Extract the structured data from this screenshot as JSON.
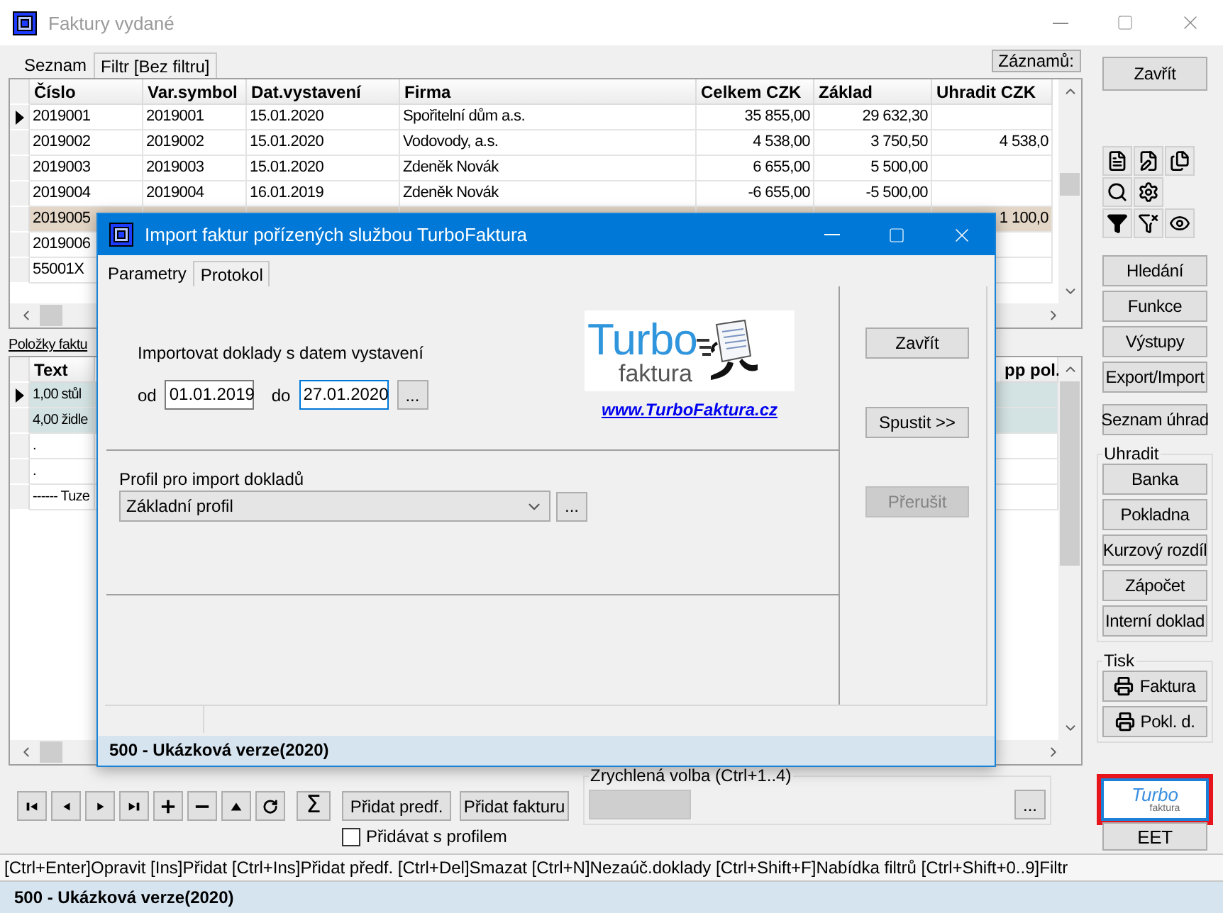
{
  "window": {
    "title": "Faktury vydané"
  },
  "tabs": [
    {
      "label": "Seznam",
      "selected": true
    },
    {
      "label": "Filtr [Bez filtru]",
      "selected": false
    }
  ],
  "records_button": "Záznamů:",
  "invoices": {
    "columns": [
      "Číslo",
      "Var.symbol",
      "Dat.vystavení",
      "Firma",
      "Celkem CZK",
      "Základ",
      "Uhradit CZK"
    ],
    "rows": [
      {
        "current": true,
        "selected": false,
        "cells": [
          "2019001",
          "2019001",
          "15.01.2020",
          "Spořitelní dům a.s.",
          "35 855,00",
          "29 632,30",
          null
        ]
      },
      {
        "current": false,
        "selected": false,
        "cells": [
          "2019002",
          "2019002",
          "15.01.2020",
          "Vodovody, a.s.",
          "4 538,00",
          "3 750,50",
          "4 538,0"
        ]
      },
      {
        "current": false,
        "selected": false,
        "cells": [
          "2019003",
          "2019003",
          "15.01.2020",
          "Zdeněk Novák",
          "6 655,00",
          "5 500,00",
          null
        ]
      },
      {
        "current": false,
        "selected": false,
        "cells": [
          "2019004",
          "2019004",
          "16.01.2019",
          "Zdeněk Novák",
          "-6 655,00",
          "-5 500,00",
          null
        ]
      },
      {
        "current": false,
        "selected": true,
        "cells": [
          "2019005",
          null,
          null,
          null,
          null,
          null,
          "1 100,0"
        ]
      },
      {
        "current": false,
        "selected": false,
        "cells": [
          "2019006",
          null,
          null,
          null,
          null,
          null,
          null
        ]
      },
      {
        "current": false,
        "selected": false,
        "cells": [
          "55001X",
          null,
          null,
          null,
          null,
          null,
          null
        ]
      }
    ]
  },
  "items": {
    "label": "Položky faktu",
    "columns": [
      "Text",
      "pp pol."
    ],
    "rows": [
      {
        "current": true,
        "selected": true,
        "cells": [
          "1,00 stůl",
          null
        ]
      },
      {
        "current": false,
        "selected": true,
        "cells": [
          "4,00 židle",
          null
        ]
      },
      {
        "current": false,
        "selected": false,
        "cells": [
          ".",
          null
        ]
      },
      {
        "current": false,
        "selected": false,
        "cells": [
          ".",
          null
        ]
      },
      {
        "current": false,
        "selected": false,
        "cells": [
          "------ Tuze",
          null
        ]
      }
    ]
  },
  "navigation": [
    {
      "kind": "first"
    },
    {
      "kind": "prev"
    },
    {
      "kind": "next"
    },
    {
      "kind": "last"
    },
    {
      "kind": "plus"
    },
    {
      "kind": "minus"
    },
    {
      "kind": "up"
    },
    {
      "kind": "refresh"
    }
  ],
  "sum_button": "Σ",
  "add_buttons": [
    "Přidat predf.",
    "Přidat fakturu"
  ],
  "profile_checkbox": {
    "label": "Přidávat s profilem",
    "checked": false
  },
  "quick_choice": {
    "title": "Zrychlená volba (Ctrl+1..4)",
    "button": "..."
  },
  "sidebar": {
    "close": "Zavřít",
    "tools": [
      {
        "kind": "document"
      },
      {
        "kind": "edit"
      },
      {
        "kind": "copy"
      },
      {
        "kind": "search"
      },
      {
        "kind": "settings"
      },
      {
        "kind": "empty"
      },
      {
        "kind": "filter"
      },
      {
        "kind": "filter-clear"
      },
      {
        "kind": "view"
      }
    ],
    "buttons": [
      "Hledání",
      "Funkce",
      "Výstupy",
      "Export/Import"
    ],
    "payments_button": "Seznam úhrad",
    "pay_group": {
      "title": "Uhradit",
      "buttons": [
        "Banka",
        "Pokladna",
        "Kurzový rozdíl",
        "Zápočet",
        "Interní doklad"
      ]
    },
    "print_group": {
      "title": "Tisk",
      "buttons": [
        "Faktura",
        "Pokl. d."
      ]
    },
    "turbo_button": {
      "title": "Turbo",
      "subtitle": "faktura",
      "selected": true
    },
    "eet_button": "EET"
  },
  "shortcuts": "[Ctrl+Enter]Opravit [Ins]Přidat [Ctrl+Ins]Přidat předf.  [Ctrl+Del]Smazat [Ctrl+N]Nezaúč.doklady  [Ctrl+Shift+F]Nabídka filtrů [Ctrl+Shift+0..9]Filtr",
  "status_bar": "500 - Ukázková verze(2020)",
  "dialog": {
    "title": "Import faktur pořízených službou TurboFaktura",
    "tabs": [
      {
        "label": "Parametry",
        "selected": true
      },
      {
        "label": "Protokol",
        "selected": false
      }
    ],
    "date_label": "Importovat doklady s datem vystavení",
    "from_label": "od",
    "from_value": "01.01.2019",
    "to_label": "do",
    "to_value": "27.01.2020",
    "to_focused": true,
    "picker_button": "...",
    "logo": {
      "title": "Turbo",
      "subtitle": "faktura",
      "link": "www.TurboFaktura.cz"
    },
    "profile_label": "Profil pro import dokladů",
    "profile_value": "Základní profil",
    "profile_button": "...",
    "buttons": [
      {
        "label": "Zavřít",
        "disabled": false
      },
      {
        "label": "Spustit >>",
        "disabled": false
      },
      {
        "label": "Přerušit",
        "disabled": true
      }
    ],
    "status_bar": "500 - Ukázková verze(2020)"
  }
}
